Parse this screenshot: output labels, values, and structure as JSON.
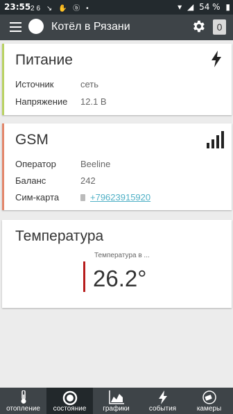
{
  "status_bar": {
    "time": "23:55",
    "icons": "26 ↘ ✋ ⓑ •",
    "battery_percent": "54 %"
  },
  "app_bar": {
    "title": "Котёл в Рязани",
    "badge_count": "0"
  },
  "cards": {
    "power": {
      "title": "Питание",
      "rows": [
        {
          "label": "Источник",
          "value": "сеть"
        },
        {
          "label": "Напряжение",
          "value": "12.1 В"
        }
      ],
      "accent_color": "#b9d263"
    },
    "gsm": {
      "title": "GSM",
      "rows": [
        {
          "label": "Оператор",
          "value": "Beeline"
        },
        {
          "label": "Баланс",
          "value": "242"
        },
        {
          "label": "Сим-карта",
          "value": "+79623915920"
        }
      ],
      "accent_color": "#e3876b"
    },
    "temperature": {
      "title": "Температура",
      "sensor_label": "Температура в ...",
      "value": "26.2°",
      "bar_color": "#b71c1c"
    }
  },
  "bottom_nav": [
    {
      "label": "отопление",
      "icon": "thermometer-icon"
    },
    {
      "label": "состояние",
      "icon": "status-circle-icon",
      "active": true
    },
    {
      "label": "графики",
      "icon": "chart-icon"
    },
    {
      "label": "события",
      "icon": "bolt-icon"
    },
    {
      "label": "камеры",
      "icon": "camera-icon"
    }
  ],
  "colors": {
    "app_bar": "#3e4448",
    "status_bar": "#232a2e",
    "active_tab": "#22282b",
    "link": "#4fb0c6"
  }
}
